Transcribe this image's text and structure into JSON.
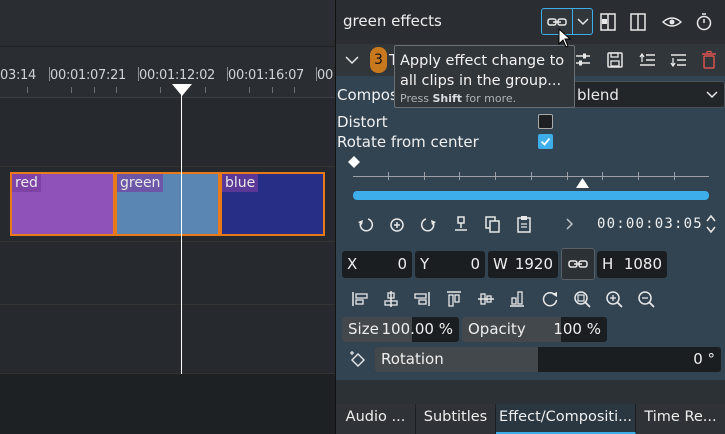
{
  "timeline": {
    "ruler_ticks": [
      "03:14",
      "00:01:07:21",
      "00:01:12:02",
      "00:01:16:07",
      "00"
    ],
    "clips": [
      {
        "label": "red",
        "color": "#8e52b8"
      },
      {
        "label": "green",
        "color": "#5a86b4"
      },
      {
        "label": "blue",
        "color": "#262e86"
      }
    ]
  },
  "effect_panel": {
    "title": "green effects",
    "header_icons": [
      "link-group-icon",
      "dropdown-chevron-icon",
      "split-compare-icon",
      "split-view-icon",
      "eye-icon",
      "timer-icon"
    ],
    "effect_row": {
      "badge": "3",
      "name_fragment": "T",
      "icons": [
        "collapse-chevron-icon",
        "adjust-icon",
        "save-icon",
        "move-up-icon",
        "move-down-icon",
        "delete-icon"
      ]
    },
    "composition_label": "Compositi",
    "composition_value": "blend",
    "distort_label": "Distort",
    "distort_checked": false,
    "rotate_label": "Rotate from center",
    "rotate_checked": true,
    "timecode": "00:00:03:05",
    "geometry": {
      "x_label": "X",
      "x_value": "0",
      "y_label": "Y",
      "y_value": "0",
      "w_label": "W",
      "w_value": "1920",
      "h_label": "H",
      "h_value": "1080"
    },
    "size_label": "Size",
    "size_value": "100.00 %",
    "size_level": 0.6,
    "opacity_label": "Opacity",
    "opacity_value": "100 %",
    "opacity_level": 0.68,
    "rotation_label": "Rotation",
    "rotation_value": "0 °",
    "rotation_level": 0.47
  },
  "tabs": [
    "Audio ...",
    "Subtitles",
    "Effect/Compositi...",
    "Time Re..."
  ],
  "active_tab": 2,
  "tooltip": {
    "main": "Apply effect change to all clips in the group...",
    "hint_prefix": "Press ",
    "hint_key": "Shift",
    "hint_suffix": " for more."
  },
  "colors": {
    "accent": "#3daee9",
    "clip_border": "#e87a1a",
    "badge": "#c8781d",
    "delete": "#d9534f"
  }
}
